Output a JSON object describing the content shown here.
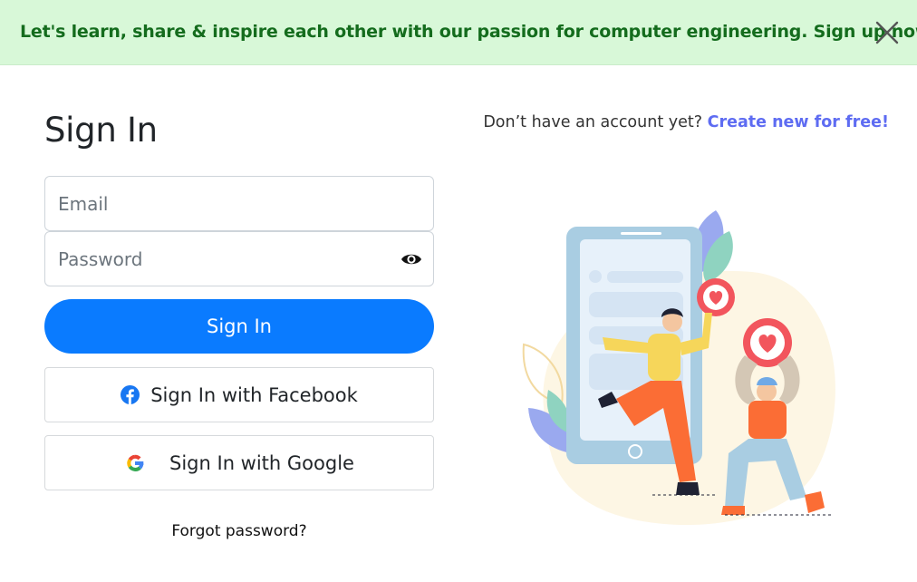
{
  "banner": {
    "text": "Let's learn, share & inspire each other with our passion for computer engineering. Sign up now",
    "close_icon": "close-icon"
  },
  "header": {
    "prompt": "Don’t have an account yet?",
    "create_link": "Create new for free!"
  },
  "form": {
    "title": "Sign In",
    "email_placeholder": "Email",
    "password_placeholder": "Password",
    "show_password_icon": "eye-icon",
    "submit_label": "Sign In",
    "facebook_label": "Sign In with Facebook",
    "google_label": "Sign In with Google",
    "forgot_label": "Forgot password?"
  },
  "colors": {
    "banner_bg": "#d8f8d8",
    "banner_text": "#146c1d",
    "primary": "#0a7bff",
    "link": "#5e6cf2"
  }
}
